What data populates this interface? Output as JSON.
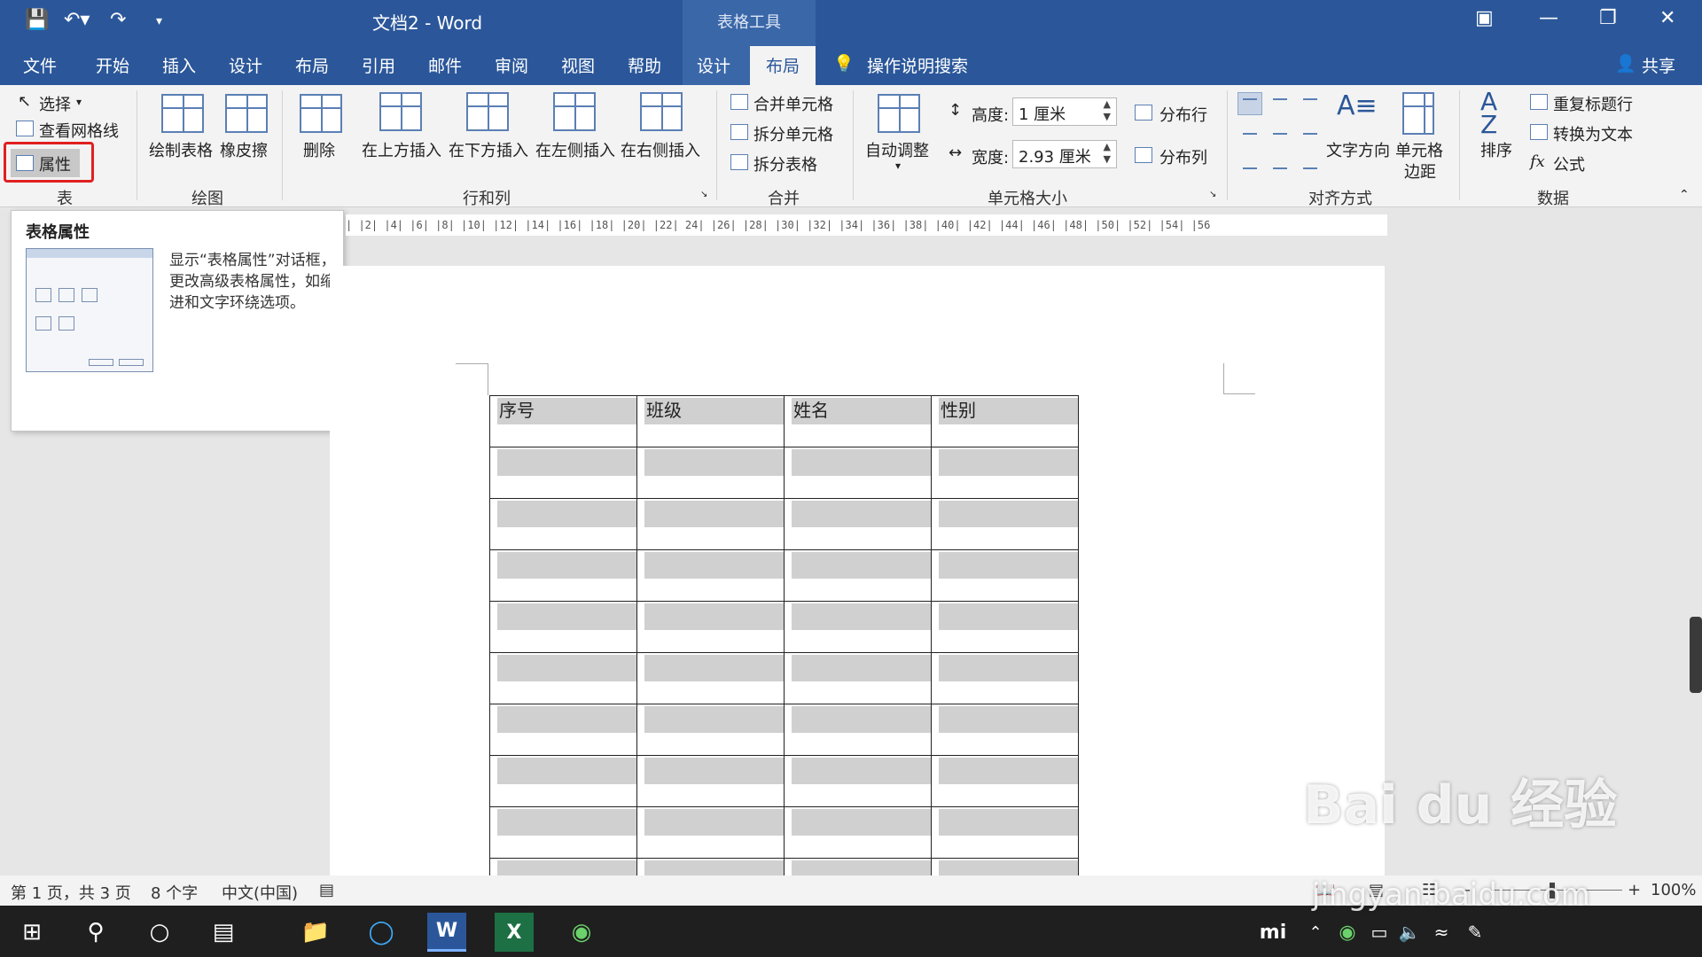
{
  "titlebar": {
    "doc_title": "文档2  -  Word",
    "context_title": "表格工具"
  },
  "tabs": [
    "文件",
    "开始",
    "插入",
    "设计",
    "布局",
    "引用",
    "邮件",
    "审阅",
    "视图",
    "帮助",
    "设计",
    "布局"
  ],
  "tell_me": "操作说明搜索",
  "share": "共享",
  "ribbon": {
    "table_group": {
      "select": "选择",
      "gridlines": "查看网格线",
      "properties": "属性",
      "label": "表"
    },
    "draw_group": {
      "draw": "绘制表格",
      "eraser": "橡皮擦",
      "label": "绘图"
    },
    "rows_group": {
      "delete": "删除",
      "insert_above": "在上方插入",
      "insert_below": "在下方插入",
      "insert_left": "在左侧插入",
      "insert_right": "在右侧插入",
      "label": "行和列"
    },
    "merge_group": {
      "merge": "合并单元格",
      "split_cells": "拆分单元格",
      "split_table": "拆分表格",
      "label": "合并"
    },
    "size_group": {
      "autofit": "自动调整",
      "height_label": "高度:",
      "height_value": "1 厘米",
      "width_label": "宽度:",
      "width_value": "2.93 厘米",
      "dist_rows": "分布行",
      "dist_cols": "分布列",
      "label": "单元格大小"
    },
    "align_group": {
      "text_direction": "文字方向",
      "margins_1": "单元格",
      "margins_2": "边距",
      "label": "对齐方式"
    },
    "data_group": {
      "sort": "排序",
      "repeat_header": "重复标题行",
      "convert": "转换为文本",
      "formula": "公式",
      "label": "数据"
    }
  },
  "tooltip": {
    "title": "表格属性",
    "description": "显示“表格属性”对话框，更改高级表格属性，如缩进和文字环绕选项。"
  },
  "ruler": "|  |2|  |4|  |6|    |8|  |10|  |12|  |14|    |16|  |18|  |20|  |22|    24|  |26|  |28|  |30|  |32|  |34|  |36|  |38|  |40|  |42|  |44|  |46|  |48|  |50|  |52|  |54|  |56",
  "table": {
    "headers": [
      "序号",
      "班级",
      "姓名",
      "性别"
    ],
    "empty_rows": 9
  },
  "status": {
    "page": "第 1 页，共 3 页",
    "words": "8 个字",
    "language": "中文(中国)",
    "zoom": "100%"
  },
  "watermark": {
    "brand": "Bai du 经验",
    "url": "jingyan.baidu.com"
  },
  "colors": {
    "title_blue": "#2b579a",
    "highlight_red": "#e02020"
  }
}
